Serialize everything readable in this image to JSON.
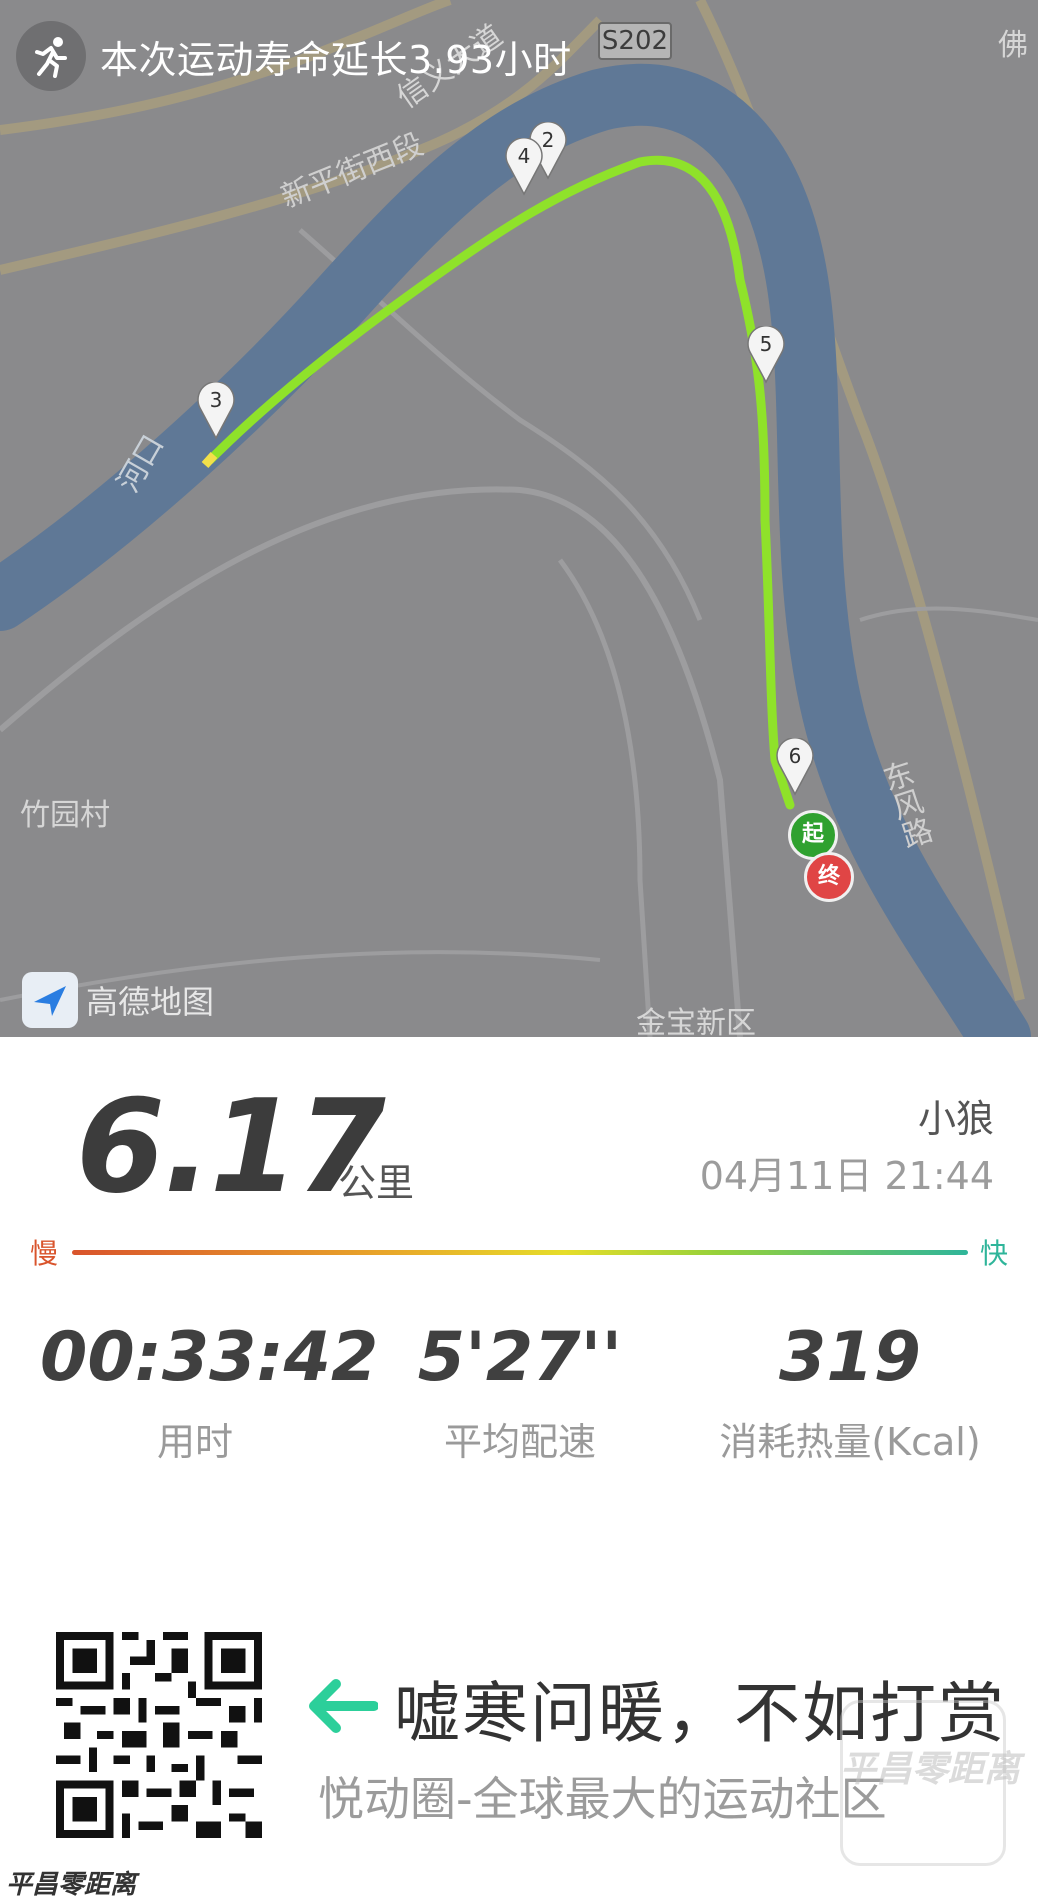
{
  "banner": {
    "text": "本次运动寿命延长3.93小时",
    "icon": "runner-icon"
  },
  "map": {
    "labels": {
      "road_north": "信义大道",
      "road_west": "新平街西段",
      "road_code": "S202",
      "corner": "佛",
      "river": "河口",
      "village": "竹园村",
      "road_east": "东风路",
      "district": "金宝新区"
    },
    "markers": [
      "3",
      "4",
      "2",
      "5",
      "6"
    ],
    "start_label": "起",
    "end_label": "终",
    "provider": "高德地图",
    "route_color": "#8fe22a"
  },
  "summary": {
    "distance": "6.17",
    "unit": "公里",
    "user": "小狼",
    "datetime": "04月11日 21:44",
    "slow_label": "慢",
    "fast_label": "快"
  },
  "metrics": [
    {
      "value": "00:33:42",
      "label": "用时"
    },
    {
      "value": "5'27''",
      "label": "平均配速"
    },
    {
      "value": "319",
      "label": "消耗热量(Kcal)"
    }
  ],
  "promo": {
    "slogan": "嘘寒问暖，不如打赏",
    "subtitle": "悦动圈-全球最大的运动社区",
    "arrow_icon": "left-arrow-icon"
  },
  "watermark": {
    "text": "平昌零距离"
  }
}
